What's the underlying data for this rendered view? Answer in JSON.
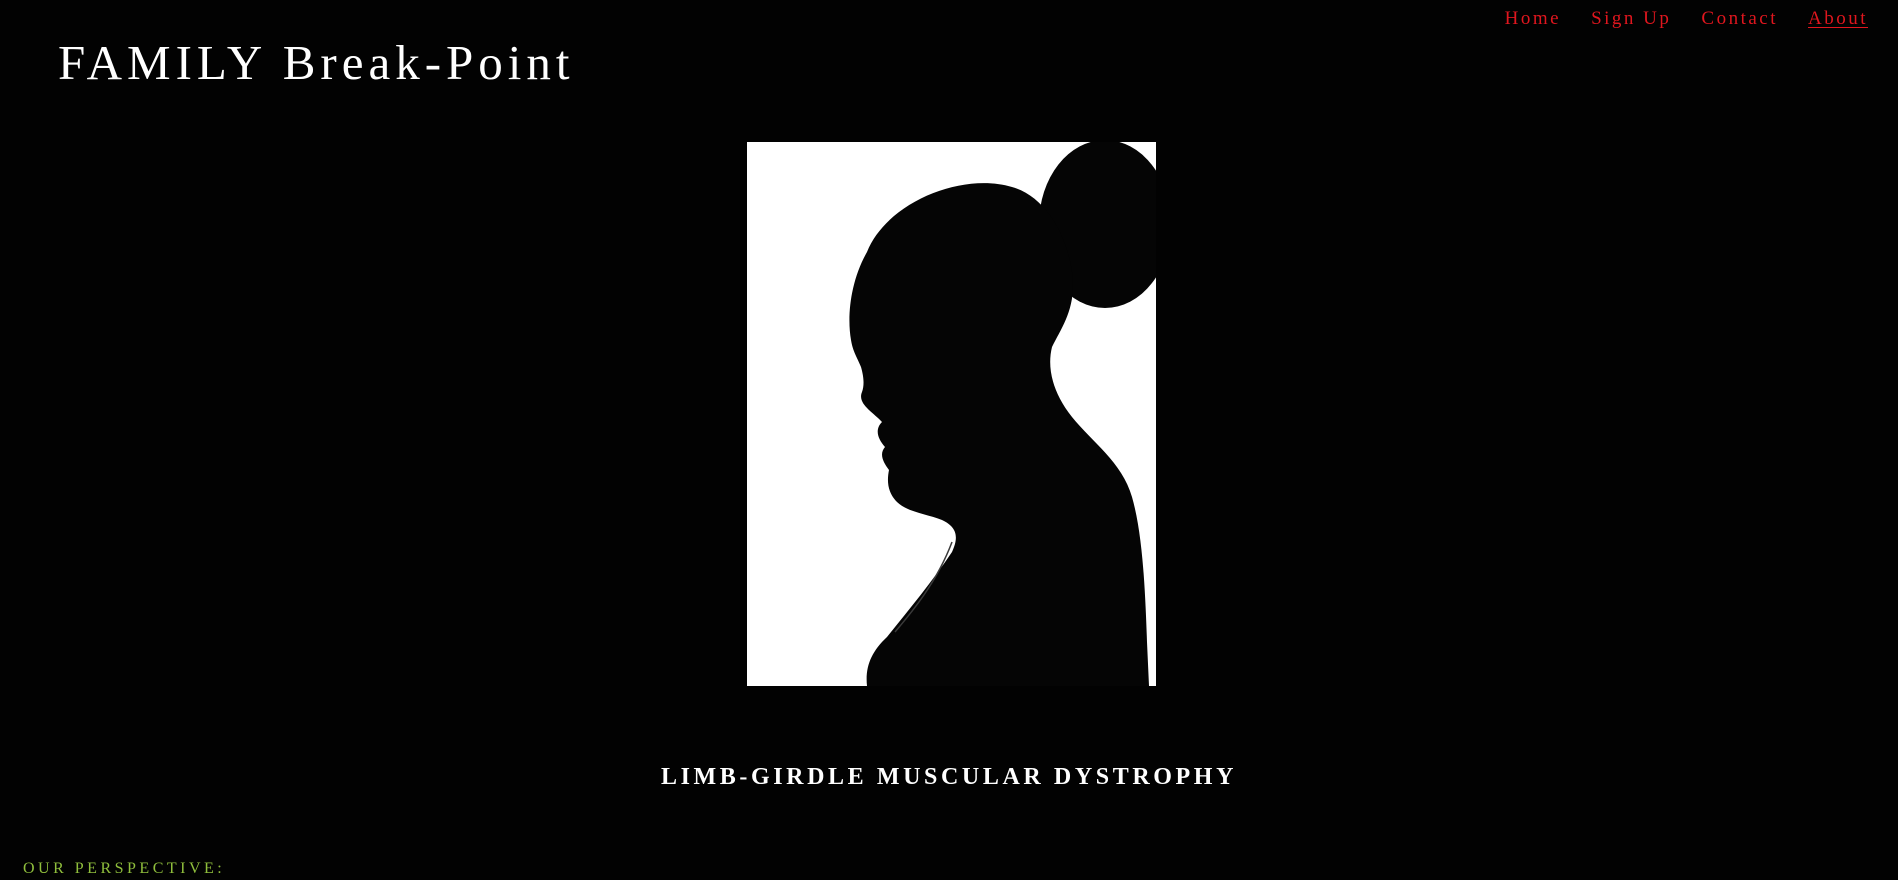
{
  "site": {
    "title": "FAMILY Break-Point"
  },
  "nav": {
    "items": [
      {
        "label": "Home",
        "active": false
      },
      {
        "label": "Sign Up",
        "active": false
      },
      {
        "label": "Contact",
        "active": false
      },
      {
        "label": "About",
        "active": true
      }
    ],
    "color": "#e0161e"
  },
  "hero": {
    "image_subject": "silhouette-profile-photo"
  },
  "content": {
    "condition_heading": "LIMB-GIRDLE MUSCULAR DYSTROPHY",
    "perspective_label": "OUR PERSPECTIVE:",
    "perspective_color": "#8fbe3c"
  },
  "colors": {
    "background": "#020202",
    "text": "#ffffff"
  }
}
